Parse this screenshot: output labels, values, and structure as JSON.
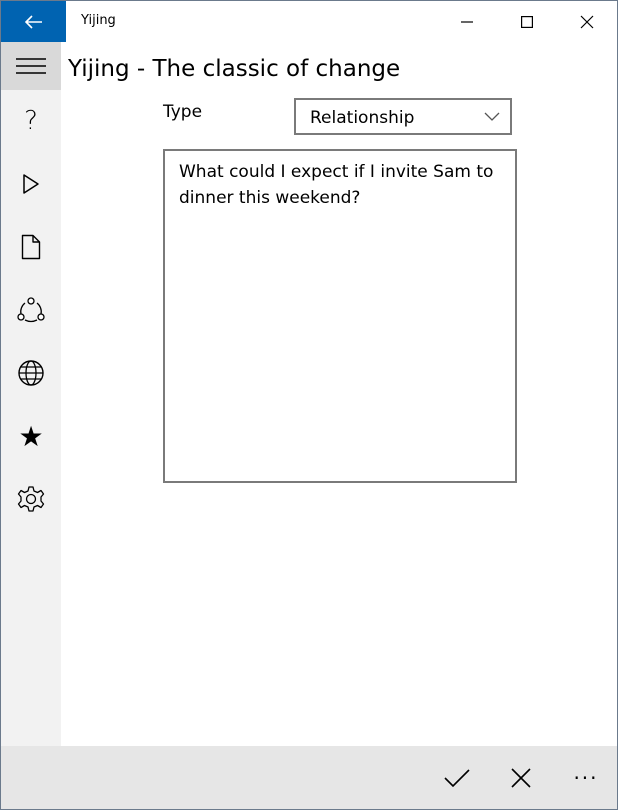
{
  "window": {
    "title": "Yijing",
    "controls": [
      "minimize",
      "maximize",
      "close"
    ]
  },
  "nav": {
    "items": [
      {
        "icon": "hamburger-icon"
      },
      {
        "icon": "help-icon",
        "glyph": "?"
      },
      {
        "icon": "play-icon"
      },
      {
        "icon": "document-icon"
      },
      {
        "icon": "share-icon"
      },
      {
        "icon": "globe-icon"
      },
      {
        "icon": "star-icon",
        "glyph": "★"
      },
      {
        "icon": "settings-icon"
      }
    ]
  },
  "main": {
    "title": "Yijing - The classic of change",
    "type_label": "Type",
    "type_value": "Relationship",
    "question": "What could I expect if I invite Sam to dinner this weekend?"
  },
  "commandbar": {
    "items": [
      {
        "icon": "checkmark-icon"
      },
      {
        "icon": "cancel-icon"
      },
      {
        "icon": "more-icon",
        "glyph": "···"
      }
    ]
  },
  "colors": {
    "accent": "#0063b1",
    "nav_bg": "#f2f2f2",
    "hamburger_bg": "#d9d9d9",
    "cmdbar_bg": "#e6e6e6",
    "border": "#7a7a7a"
  }
}
